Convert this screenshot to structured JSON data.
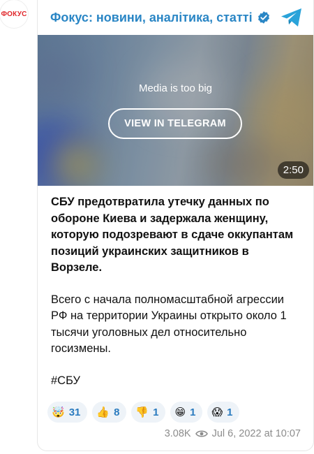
{
  "channel": {
    "avatar_text": "ФОКУС",
    "name": "Фокус: новини, аналітика, статті"
  },
  "media": {
    "notice": "Media is too big",
    "button_label": "VIEW IN TELEGRAM",
    "duration": "2:50"
  },
  "post": {
    "bold_text": "СБУ предотвратила утечку данных по обороне Киева и задержала женщину, которую подозревают в сдаче оккупантам позиций украинских защитников в Ворзеле.",
    "body_text": "Всего с начала полномасштабной агрессии РФ на территории Украины открыто около 1 тысячи уголовных дел относительно госизмены.",
    "hashtag": "#СБУ"
  },
  "reactions": [
    {
      "emoji": "🤯",
      "count": "31"
    },
    {
      "emoji": "👍",
      "count": "8"
    },
    {
      "emoji": "👎",
      "count": "1"
    },
    {
      "emoji": "😁",
      "count": "1"
    },
    {
      "emoji": "😱",
      "count": "1"
    }
  ],
  "footer": {
    "views": "3.08K",
    "date": "Jul 6, 2022 at 10:07"
  },
  "colors": {
    "accent": "#2a86c5",
    "telegram": "#2aa3d9",
    "reaction_bg": "#eef3f8",
    "brand_red": "#e0262a"
  },
  "icons": {
    "verified": "verified-badge-icon",
    "telegram": "telegram-logo-icon",
    "views": "eye-icon"
  }
}
